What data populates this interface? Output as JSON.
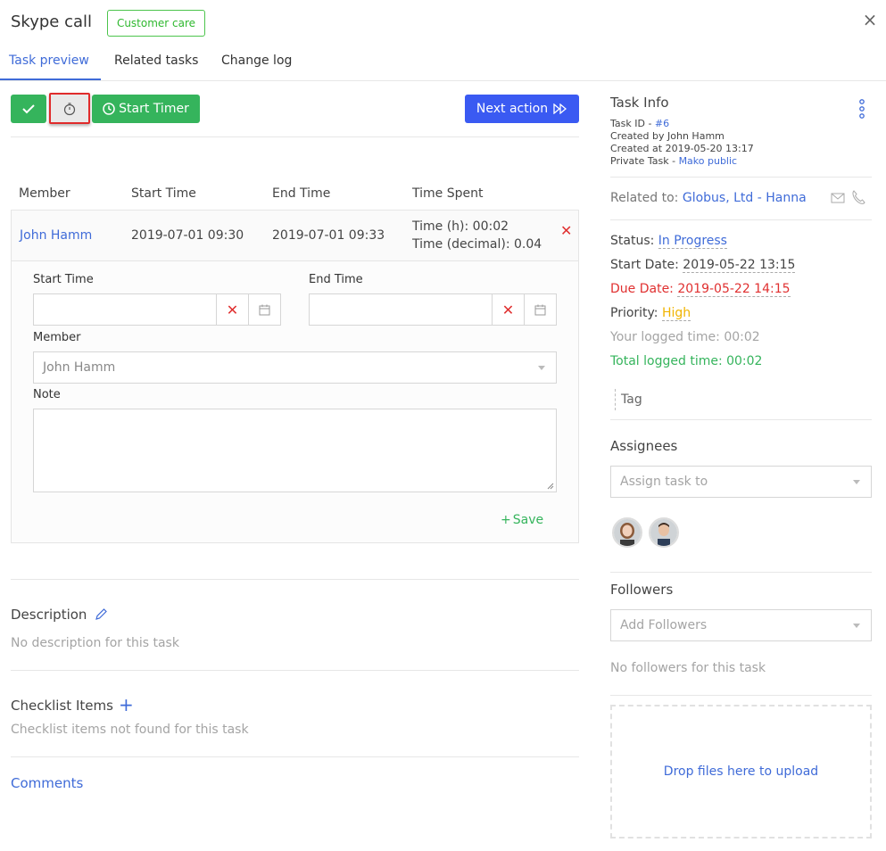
{
  "header": {
    "title": "Skype call",
    "badge": "Customer care",
    "close": "×"
  },
  "tabs": [
    {
      "label": "Task preview",
      "active": true
    },
    {
      "label": "Related tasks",
      "active": false
    },
    {
      "label": "Change log",
      "active": false
    }
  ],
  "toolbar": {
    "start_timer": "Start Timer",
    "next_action": "Next action"
  },
  "timesheet": {
    "headers": [
      "Member",
      "Start Time",
      "End Time",
      "Time Spent"
    ],
    "row": {
      "member": "John Hamm",
      "start": "2019-07-01 09:30",
      "end": "2019-07-01 09:33",
      "time_h": "Time (h): 00:02",
      "time_dec": "Time (decimal): 0.04"
    }
  },
  "edit_form": {
    "start_label": "Start Time",
    "end_label": "End Time",
    "member_label": "Member",
    "member_value": "John Hamm",
    "note_label": "Note",
    "save": "Save"
  },
  "description": {
    "title": "Description",
    "empty": "No description for this task"
  },
  "checklist": {
    "title": "Checklist Items",
    "empty": "Checklist items not found for this task"
  },
  "comments": {
    "title": "Comments"
  },
  "task_info": {
    "title": "Task Info",
    "task_id_label": "Task ID - ",
    "task_id": "#6",
    "created_by": "Created by John Hamm",
    "created_at": "Created at 2019-05-20 13:17",
    "private_label": "Private Task - ",
    "private_value": "Mako public",
    "related_label": "Related to: ",
    "related_value": "Globus, Ltd - Hanna",
    "status_label": "Status: ",
    "status_value": "In Progress",
    "start_label": "Start Date: ",
    "start_value": "2019-05-22 13:15",
    "due_label": "Due Date: ",
    "due_value": "2019-05-22 14:15",
    "priority_label": "Priority: ",
    "priority_value": "High",
    "your_logged": "Your logged time: 00:02",
    "total_logged": "Total logged time: 00:02",
    "tag": "Tag"
  },
  "assignees": {
    "title": "Assignees",
    "placeholder": "Assign task to"
  },
  "followers": {
    "title": "Followers",
    "placeholder": "Add Followers",
    "empty": "No followers for this task"
  },
  "dropzone": {
    "text": "Drop files here to upload"
  },
  "colors": {
    "accent": "#3f6bd8",
    "green": "#35b45c",
    "blue_button": "#3a5af2",
    "danger": "#e03030",
    "warning": "#f0b400"
  }
}
